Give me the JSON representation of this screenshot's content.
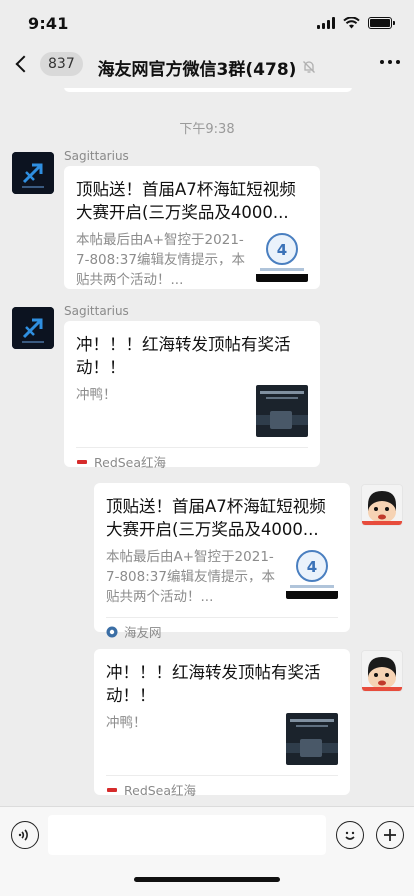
{
  "status": {
    "time": "9:41"
  },
  "nav": {
    "unread_count": "837",
    "title": "海友网官方微信3群(478)"
  },
  "chat": {
    "timestamp": "下午9:38",
    "messages": [
      {
        "sender": "Sagittarius",
        "title": "顶贴送！首届A7杯海缸短视频大赛开启(三万奖品及4000...",
        "desc": "本帖最后由A+智控于2021-7-808:37编辑友情提示，本贴共两个活动！...",
        "source": ""
      },
      {
        "sender": "Sagittarius",
        "title": "冲！！！红海转发顶帖有奖活动！！",
        "desc": "冲鸭！",
        "source": "RedSea红海"
      },
      {
        "sender": "",
        "title": "顶贴送！首届A7杯海缸短视频大赛开启(三万奖品及4000...",
        "desc": "本帖最后由A+智控于2021-7-808:37编辑友情提示，本贴共两个活动！...",
        "source": "海友网"
      },
      {
        "sender": "",
        "title": "冲！！！红海转发顶帖有奖活动！！",
        "desc": "冲鸭！",
        "source": "RedSea红海"
      }
    ]
  },
  "colors": {
    "background": "#ededed",
    "bubble": "#ffffff",
    "secondary_text": "#8c8c8c"
  }
}
